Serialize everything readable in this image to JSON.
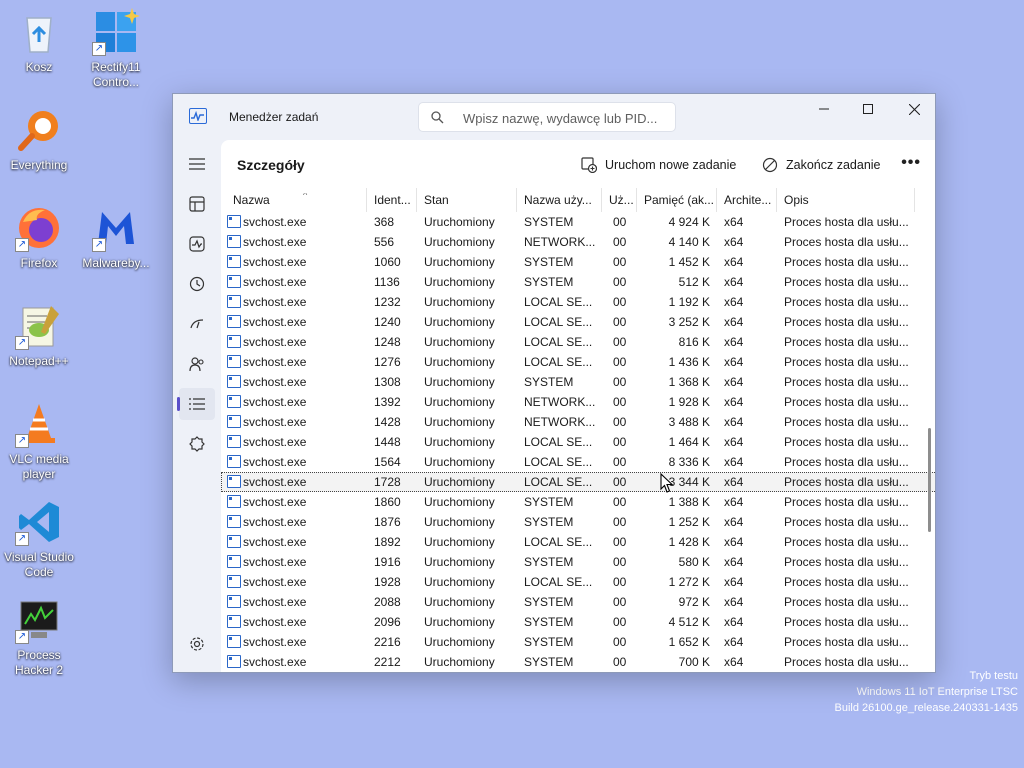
{
  "desktop": {
    "icons": [
      {
        "label": "Kosz"
      },
      {
        "label": "Rectify11 Contro..."
      },
      {
        "label": "Everything"
      },
      {
        "label": "Firefox"
      },
      {
        "label": "Malwareby..."
      },
      {
        "label": "Notepad++"
      },
      {
        "label": "VLC media player"
      },
      {
        "label": "Visual Studio Code"
      },
      {
        "label": "Process Hacker 2"
      }
    ],
    "watermark": {
      "line1": "Tryb testu",
      "line2": "Windows 11 IoT Enterprise LTSC",
      "line3": "Build 26100.ge_release.240331-1435"
    }
  },
  "window": {
    "title": "Menedżer zadań",
    "search_placeholder": "Wpisz nazwę, wydawcę lub PID...",
    "page_title": "Szczegóły",
    "run_new_task": "Uruchom nowe zadanie",
    "end_task": "Zakończ zadanie",
    "more": "•••",
    "sidebar_active": "details",
    "sidebar_icons": [
      "processes-icon",
      "performance-icon",
      "app-history-icon",
      "startup-apps-icon",
      "users-icon",
      "details-icon",
      "services-icon",
      "settings-icon"
    ]
  },
  "table": {
    "headers": {
      "name": "Nazwa",
      "pid": "Ident...",
      "status": "Stan",
      "user": "Nazwa uży...",
      "cpu": "Uż...",
      "memory": "Pamięć (ak...",
      "arch": "Archite...",
      "desc": "Opis"
    },
    "rows": [
      {
        "name": "svchost.exe",
        "pid": "368",
        "status": "Uruchomiony",
        "user": "SYSTEM",
        "cpu": "00",
        "memory": "4 924 K",
        "arch": "x64",
        "desc": "Proces hosta dla usłu..."
      },
      {
        "name": "svchost.exe",
        "pid": "556",
        "status": "Uruchomiony",
        "user": "NETWORK...",
        "cpu": "00",
        "memory": "4 140 K",
        "arch": "x64",
        "desc": "Proces hosta dla usłu..."
      },
      {
        "name": "svchost.exe",
        "pid": "1060",
        "status": "Uruchomiony",
        "user": "SYSTEM",
        "cpu": "00",
        "memory": "1 452 K",
        "arch": "x64",
        "desc": "Proces hosta dla usłu..."
      },
      {
        "name": "svchost.exe",
        "pid": "1136",
        "status": "Uruchomiony",
        "user": "SYSTEM",
        "cpu": "00",
        "memory": "512 K",
        "arch": "x64",
        "desc": "Proces hosta dla usłu..."
      },
      {
        "name": "svchost.exe",
        "pid": "1232",
        "status": "Uruchomiony",
        "user": "LOCAL SE...",
        "cpu": "00",
        "memory": "1 192 K",
        "arch": "x64",
        "desc": "Proces hosta dla usłu..."
      },
      {
        "name": "svchost.exe",
        "pid": "1240",
        "status": "Uruchomiony",
        "user": "LOCAL SE...",
        "cpu": "00",
        "memory": "3 252 K",
        "arch": "x64",
        "desc": "Proces hosta dla usłu..."
      },
      {
        "name": "svchost.exe",
        "pid": "1248",
        "status": "Uruchomiony",
        "user": "LOCAL SE...",
        "cpu": "00",
        "memory": "816 K",
        "arch": "x64",
        "desc": "Proces hosta dla usłu..."
      },
      {
        "name": "svchost.exe",
        "pid": "1276",
        "status": "Uruchomiony",
        "user": "LOCAL SE...",
        "cpu": "00",
        "memory": "1 436 K",
        "arch": "x64",
        "desc": "Proces hosta dla usłu..."
      },
      {
        "name": "svchost.exe",
        "pid": "1308",
        "status": "Uruchomiony",
        "user": "SYSTEM",
        "cpu": "00",
        "memory": "1 368 K",
        "arch": "x64",
        "desc": "Proces hosta dla usłu..."
      },
      {
        "name": "svchost.exe",
        "pid": "1392",
        "status": "Uruchomiony",
        "user": "NETWORK...",
        "cpu": "00",
        "memory": "1 928 K",
        "arch": "x64",
        "desc": "Proces hosta dla usłu..."
      },
      {
        "name": "svchost.exe",
        "pid": "1428",
        "status": "Uruchomiony",
        "user": "NETWORK...",
        "cpu": "00",
        "memory": "3 488 K",
        "arch": "x64",
        "desc": "Proces hosta dla usłu..."
      },
      {
        "name": "svchost.exe",
        "pid": "1448",
        "status": "Uruchomiony",
        "user": "LOCAL SE...",
        "cpu": "00",
        "memory": "1 464 K",
        "arch": "x64",
        "desc": "Proces hosta dla usłu..."
      },
      {
        "name": "svchost.exe",
        "pid": "1564",
        "status": "Uruchomiony",
        "user": "LOCAL SE...",
        "cpu": "00",
        "memory": "8 336 K",
        "arch": "x64",
        "desc": "Proces hosta dla usłu..."
      },
      {
        "name": "svchost.exe",
        "pid": "1728",
        "status": "Uruchomiony",
        "user": "LOCAL SE...",
        "cpu": "00",
        "memory": "3 344 K",
        "arch": "x64",
        "desc": "Proces hosta dla usłu...",
        "selected": true
      },
      {
        "name": "svchost.exe",
        "pid": "1860",
        "status": "Uruchomiony",
        "user": "SYSTEM",
        "cpu": "00",
        "memory": "1 388 K",
        "arch": "x64",
        "desc": "Proces hosta dla usłu..."
      },
      {
        "name": "svchost.exe",
        "pid": "1876",
        "status": "Uruchomiony",
        "user": "SYSTEM",
        "cpu": "00",
        "memory": "1 252 K",
        "arch": "x64",
        "desc": "Proces hosta dla usłu..."
      },
      {
        "name": "svchost.exe",
        "pid": "1892",
        "status": "Uruchomiony",
        "user": "LOCAL SE...",
        "cpu": "00",
        "memory": "1 428 K",
        "arch": "x64",
        "desc": "Proces hosta dla usłu..."
      },
      {
        "name": "svchost.exe",
        "pid": "1916",
        "status": "Uruchomiony",
        "user": "SYSTEM",
        "cpu": "00",
        "memory": "580 K",
        "arch": "x64",
        "desc": "Proces hosta dla usłu..."
      },
      {
        "name": "svchost.exe",
        "pid": "1928",
        "status": "Uruchomiony",
        "user": "LOCAL SE...",
        "cpu": "00",
        "memory": "1 272 K",
        "arch": "x64",
        "desc": "Proces hosta dla usłu..."
      },
      {
        "name": "svchost.exe",
        "pid": "2088",
        "status": "Uruchomiony",
        "user": "SYSTEM",
        "cpu": "00",
        "memory": "972 K",
        "arch": "x64",
        "desc": "Proces hosta dla usłu..."
      },
      {
        "name": "svchost.exe",
        "pid": "2096",
        "status": "Uruchomiony",
        "user": "SYSTEM",
        "cpu": "00",
        "memory": "4 512 K",
        "arch": "x64",
        "desc": "Proces hosta dla usłu..."
      },
      {
        "name": "svchost.exe",
        "pid": "2216",
        "status": "Uruchomiony",
        "user": "SYSTEM",
        "cpu": "00",
        "memory": "1 652 K",
        "arch": "x64",
        "desc": "Proces hosta dla usłu..."
      },
      {
        "name": "svchost.exe",
        "pid": "2212",
        "status": "Uruchomiony",
        "user": "SYSTEM",
        "cpu": "00",
        "memory": "700 K",
        "arch": "x64",
        "desc": "Proces hosta dla usłu..."
      }
    ]
  },
  "colors": {
    "desktop_bg": "#a9b8f2",
    "accent": "#5a4fc9",
    "icon_blue": "#2a66c8"
  }
}
